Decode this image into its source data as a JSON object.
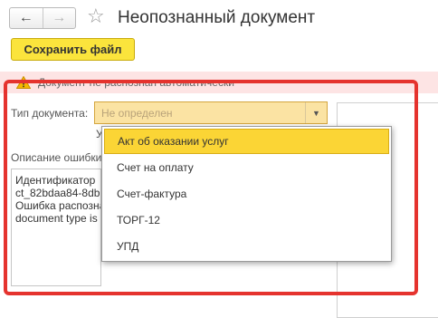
{
  "header": {
    "back_icon": "arrow-left-icon",
    "forward_icon": "arrow-right-icon",
    "favorite_icon": "star-icon",
    "title": "Неопознанный документ"
  },
  "toolbar": {
    "save_label": "Сохранить файл"
  },
  "warning": {
    "icon": "warning-icon",
    "text": "Документ не распознан автоматически",
    "background": "#fde4e4"
  },
  "form": {
    "doc_type_label": "Тип документа:",
    "doc_type_value": "Не определен",
    "hidden_field_fragment": "У",
    "error_label": "Описание ошибки",
    "error_lines": [
      "Идентификатор",
      "ct_82bdaa84-8db",
      "Ошибка распознав",
      "document type is"
    ]
  },
  "dropdown": {
    "options": [
      "Акт об оказании услуг",
      "Счет на оплату",
      "Счет-фактура",
      "ТОРГ-12",
      "УПД"
    ],
    "selected": "Акт об оказании услуг"
  },
  "colors": {
    "save_button": "#fbe43c",
    "selected_option": "#fbd535",
    "highlight_frame": "#e5332e",
    "select_field": "#fbe3a3"
  }
}
